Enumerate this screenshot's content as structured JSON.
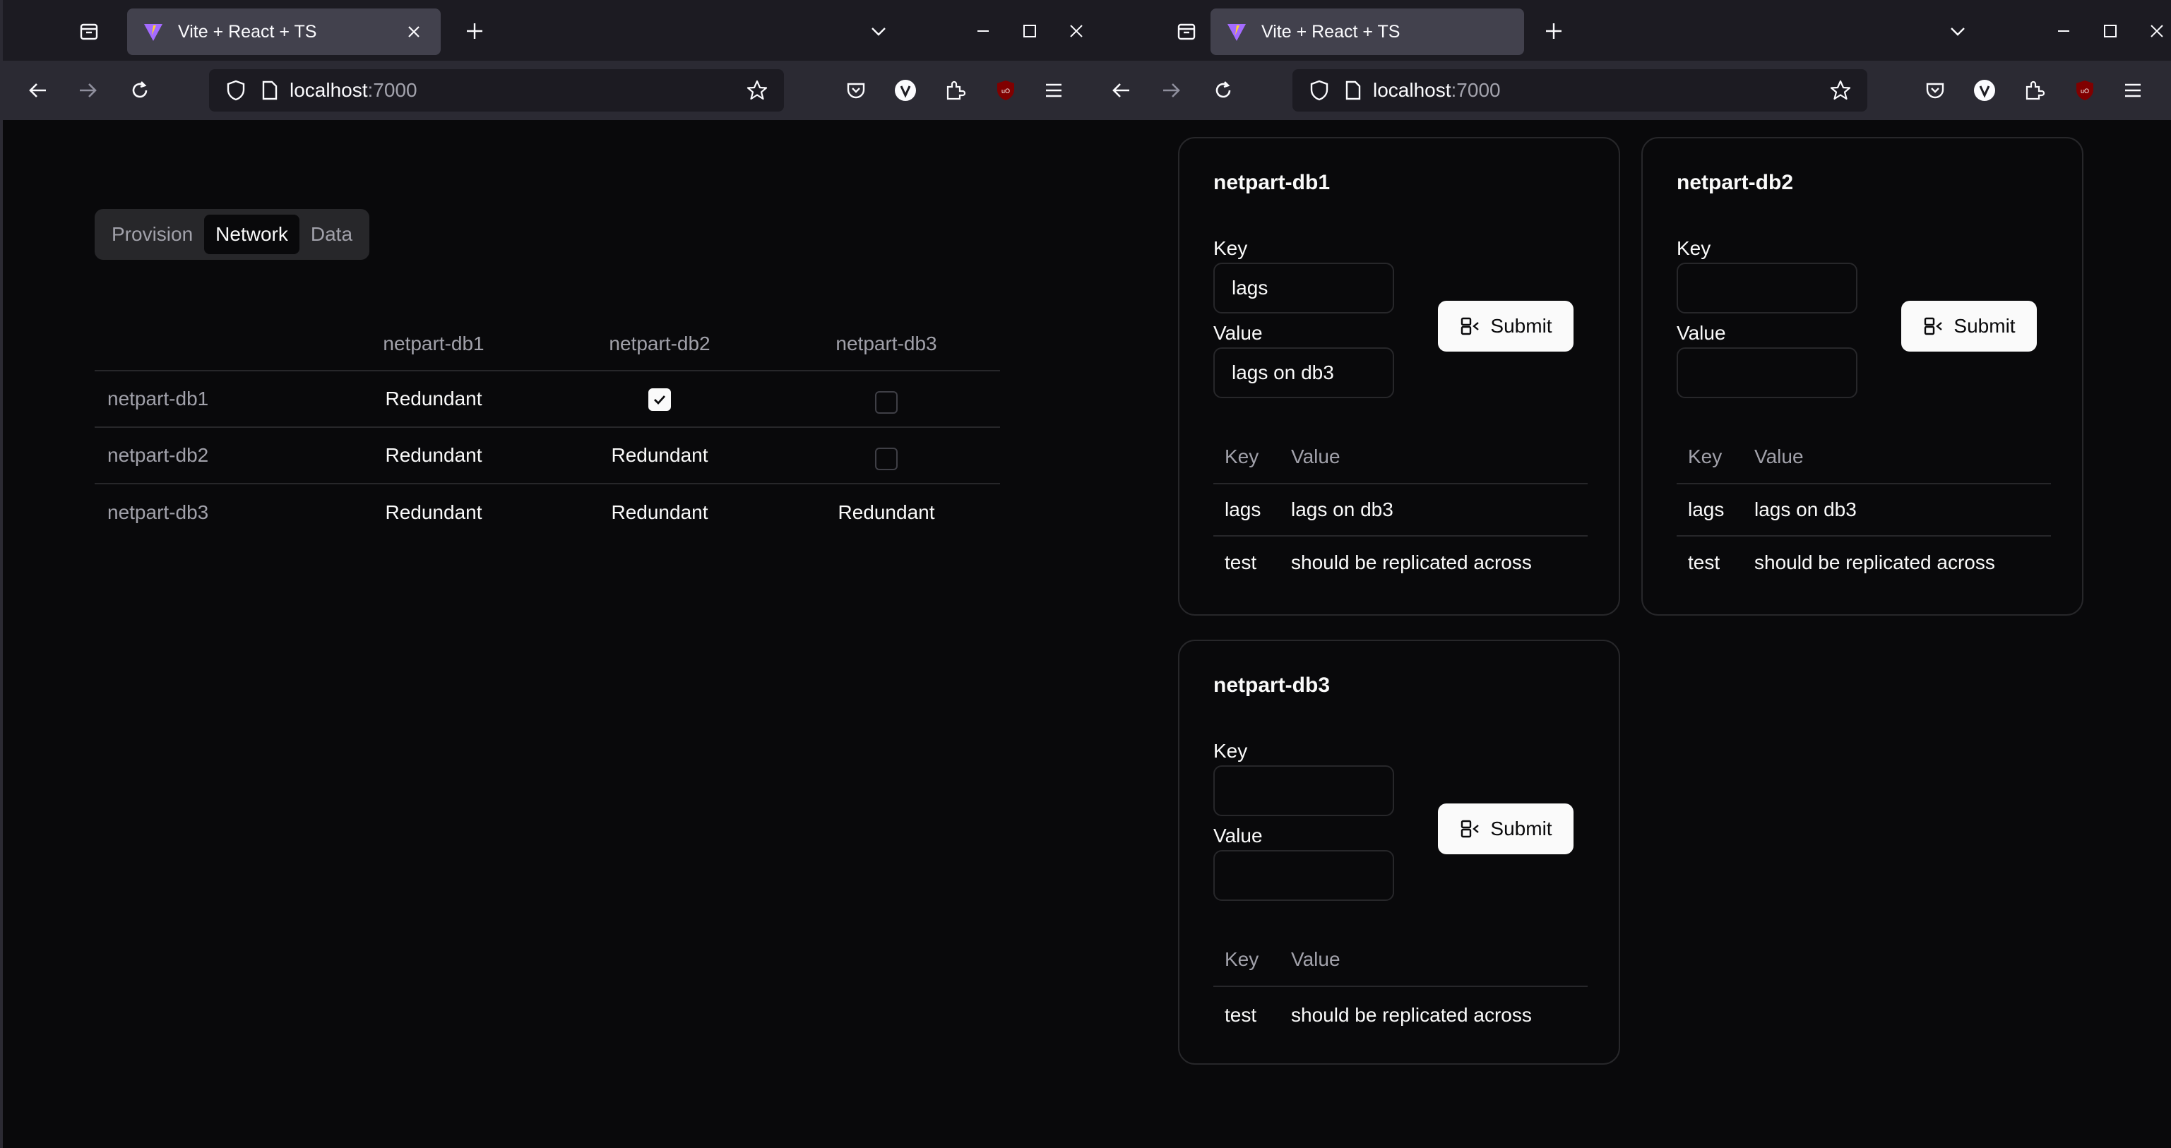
{
  "browser": {
    "tab_title": "Vite + React + TS",
    "url_host": "localhost",
    "url_port": ":7000"
  },
  "left": {
    "segments": [
      "Provision",
      "Network",
      "Data"
    ],
    "active_segment": "Network",
    "matrix": {
      "columns": [
        "netpart-db1",
        "netpart-db2",
        "netpart-db3"
      ],
      "rows": [
        {
          "name": "netpart-db1",
          "cells": [
            "Redundant",
            "checked",
            "unchecked"
          ]
        },
        {
          "name": "netpart-db2",
          "cells": [
            "Redundant",
            "Redundant",
            "unchecked"
          ]
        },
        {
          "name": "netpart-db3",
          "cells": [
            "Redundant",
            "Redundant",
            "Redundant"
          ]
        }
      ]
    }
  },
  "right": {
    "cards": [
      {
        "title": "netpart-db1",
        "key_label": "Key",
        "key_value": "lags",
        "value_label": "Value",
        "value_value": "lags on db3",
        "submit": "Submit",
        "table_head": [
          "Key",
          "Value"
        ],
        "rows": [
          {
            "key": "lags",
            "value": "lags on db3"
          },
          {
            "key": "test",
            "value": "should be replicated across"
          }
        ]
      },
      {
        "title": "netpart-db2",
        "key_label": "Key",
        "key_value": "",
        "value_label": "Value",
        "value_value": "",
        "submit": "Submit",
        "table_head": [
          "Key",
          "Value"
        ],
        "rows": [
          {
            "key": "lags",
            "value": "lags on db3"
          },
          {
            "key": "test",
            "value": "should be replicated across"
          }
        ]
      },
      {
        "title": "netpart-db3",
        "key_label": "Key",
        "key_value": "",
        "value_label": "Value",
        "value_value": "",
        "submit": "Submit",
        "table_head": [
          "Key",
          "Value"
        ],
        "rows": [
          {
            "key": "test",
            "value": "should be replicated across"
          }
        ]
      }
    ]
  }
}
